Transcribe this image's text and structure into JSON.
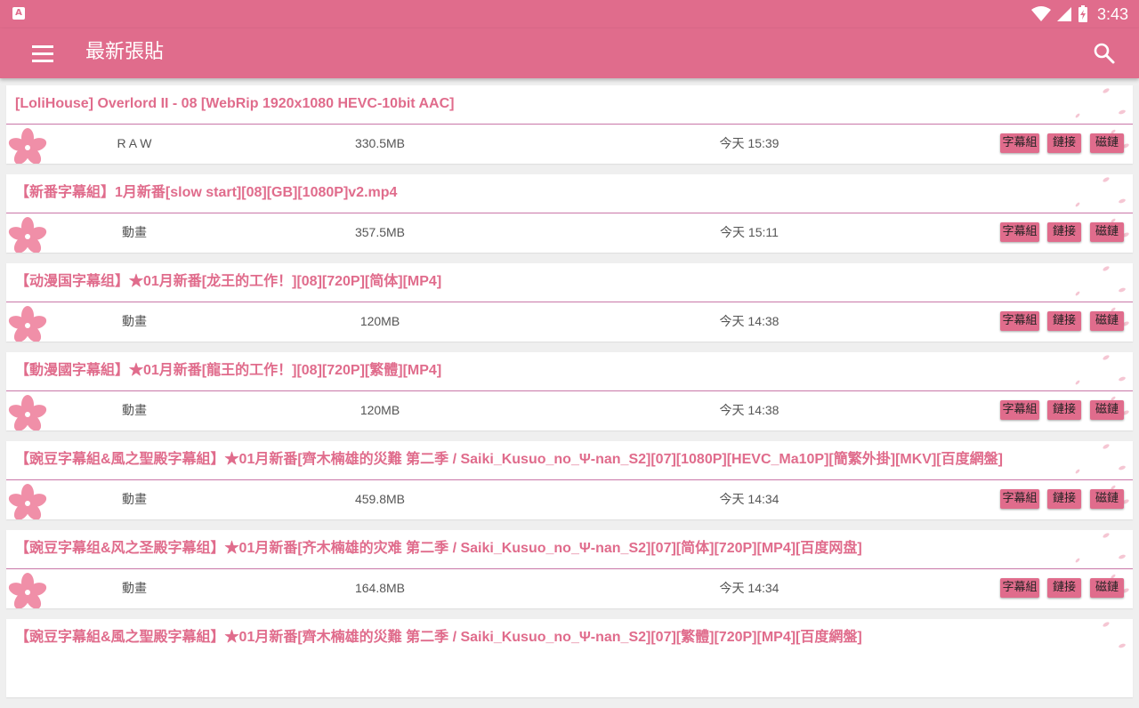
{
  "status": {
    "time": "3:43",
    "notification_icon": "A"
  },
  "appbar": {
    "title": "最新張貼"
  },
  "posts": [
    {
      "title": "[LoliHouse] Overlord II - 08 [WebRip 1920x1080 HEVC-10bit AAC]",
      "category": "R A W",
      "size": "330.5MB",
      "time": "今天 15:39",
      "btn_sub": "字幕組",
      "btn_link": "鏈接",
      "btn_magnet": "磁鏈"
    },
    {
      "title": "【新番字幕組】1月新番[slow start][08][GB][1080P]v2.mp4",
      "category": "動畫",
      "size": "357.5MB",
      "time": "今天 15:11",
      "btn_sub": "字幕組",
      "btn_link": "鏈接",
      "btn_magnet": "磁鏈"
    },
    {
      "title": "【动漫国字幕组】★01月新番[龙王的工作！][08][720P][简体][MP4]",
      "category": "動畫",
      "size": "120MB",
      "time": "今天 14:38",
      "btn_sub": "字幕組",
      "btn_link": "鏈接",
      "btn_magnet": "磁鏈"
    },
    {
      "title": "【動漫國字幕組】★01月新番[龍王的工作！][08][720P][繁體][MP4]",
      "category": "動畫",
      "size": "120MB",
      "time": "今天 14:38",
      "btn_sub": "字幕組",
      "btn_link": "鏈接",
      "btn_magnet": "磁鏈"
    },
    {
      "title": "【豌豆字幕組&風之聖殿字幕組】★01月新番[齊木楠雄的災難 第二季 / Saiki_Kusuo_no_Ψ-nan_S2][07][1080P][HEVC_Ma10P][簡繁外掛][MKV][百度網盤]",
      "category": "動畫",
      "size": "459.8MB",
      "time": "今天 14:34",
      "btn_sub": "字幕組",
      "btn_link": "鏈接",
      "btn_magnet": "磁鏈"
    },
    {
      "title": "【豌豆字幕组&风之圣殿字幕组】★01月新番[齐木楠雄的灾难 第二季 / Saiki_Kusuo_no_Ψ-nan_S2][07][简体][720P][MP4][百度网盘]",
      "category": "動畫",
      "size": "164.8MB",
      "time": "今天 14:34",
      "btn_sub": "字幕組",
      "btn_link": "鏈接",
      "btn_magnet": "磁鏈"
    },
    {
      "title": "【豌豆字幕組&風之聖殿字幕組】★01月新番[齊木楠雄的災難 第二季 / Saiki_Kusuo_no_Ψ-nan_S2][07][繁體][720P][MP4][百度網盤]",
      "category": "",
      "size": "",
      "time": "",
      "btn_sub": "",
      "btn_link": "",
      "btn_magnet": ""
    }
  ],
  "colors": {
    "primary": "#e06c8c",
    "divider": "#c977a8",
    "background": "#efefef"
  }
}
